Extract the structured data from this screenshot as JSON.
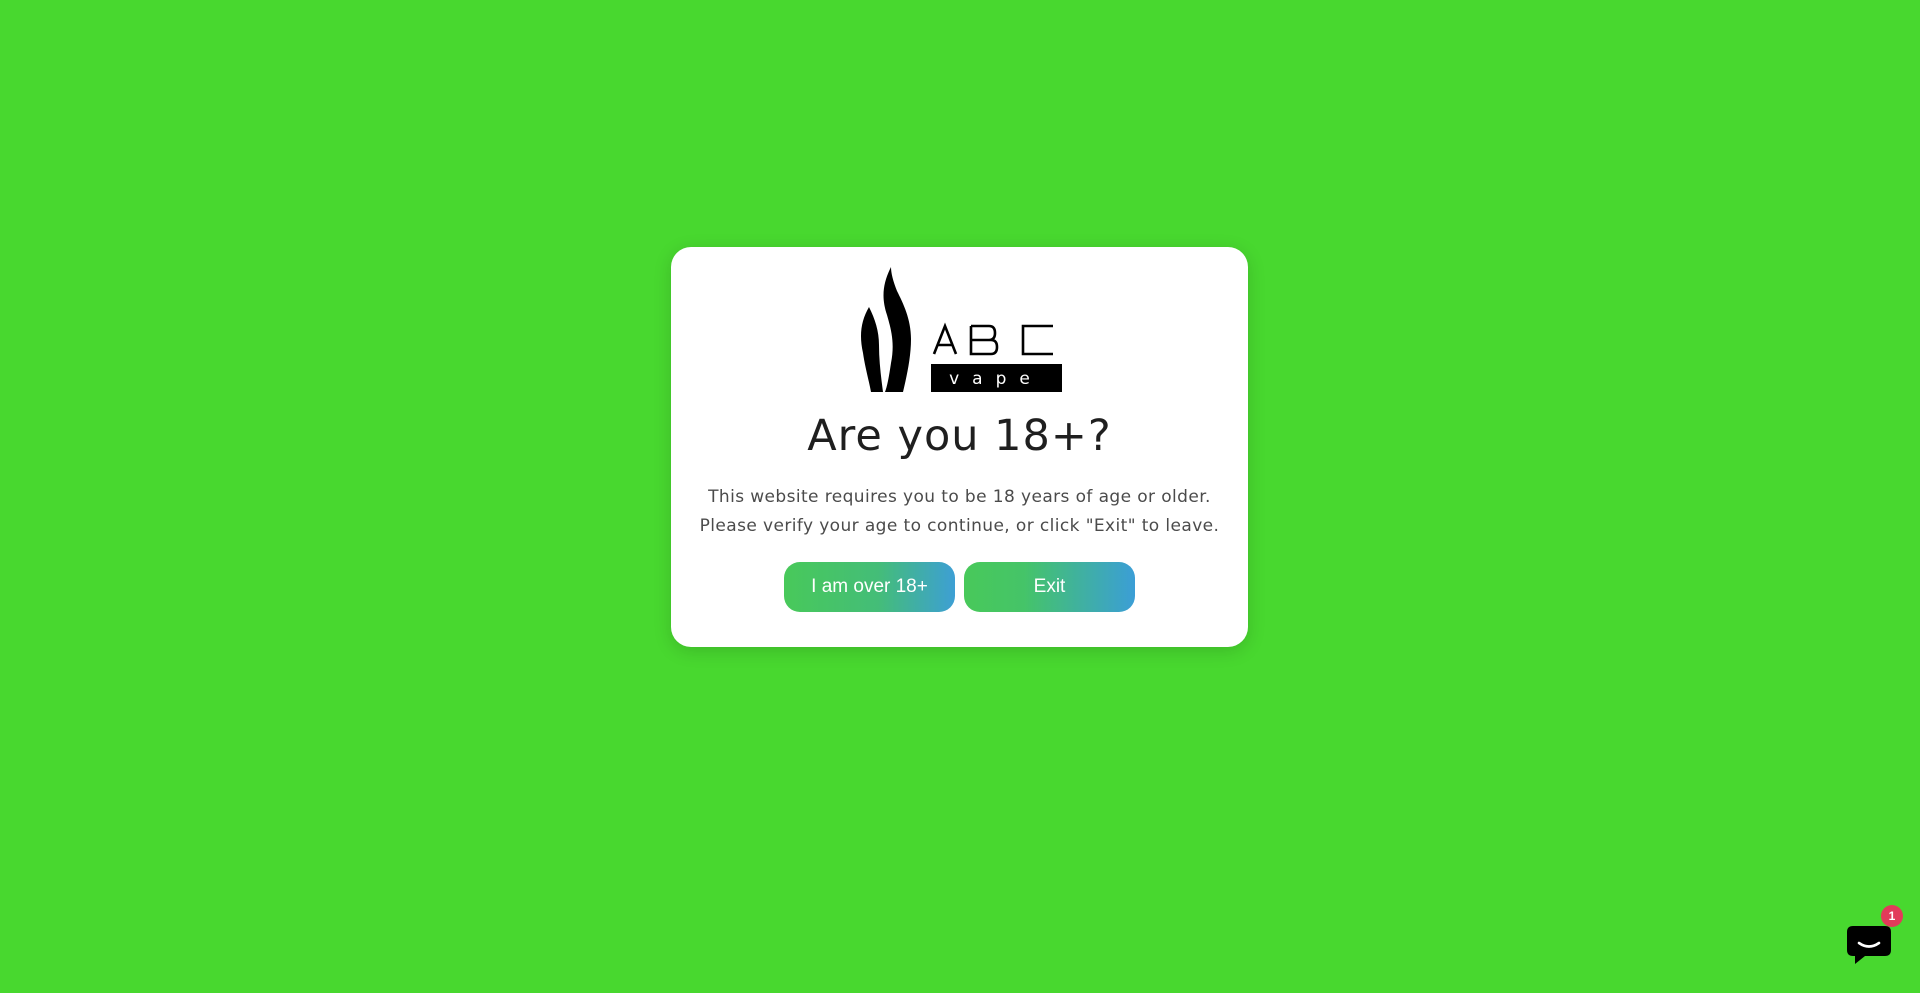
{
  "page": {
    "background_color": "#48d82f"
  },
  "age_gate": {
    "logo": {
      "brand_top": "ABC",
      "brand_bottom": "vape",
      "icon": "flame-logo-icon"
    },
    "title": "Are you 18+?",
    "description_line1": "This website requires you to be 18 years of age or older.",
    "description_line2": "Please verify your age to continue, or click \"Exit\" to leave.",
    "confirm_button_label": "I am over 18+",
    "exit_button_label": "Exit"
  },
  "chat_widget": {
    "icon": "chat-bubble-icon",
    "badge_count": "1",
    "badge_color": "#e23b5a"
  }
}
